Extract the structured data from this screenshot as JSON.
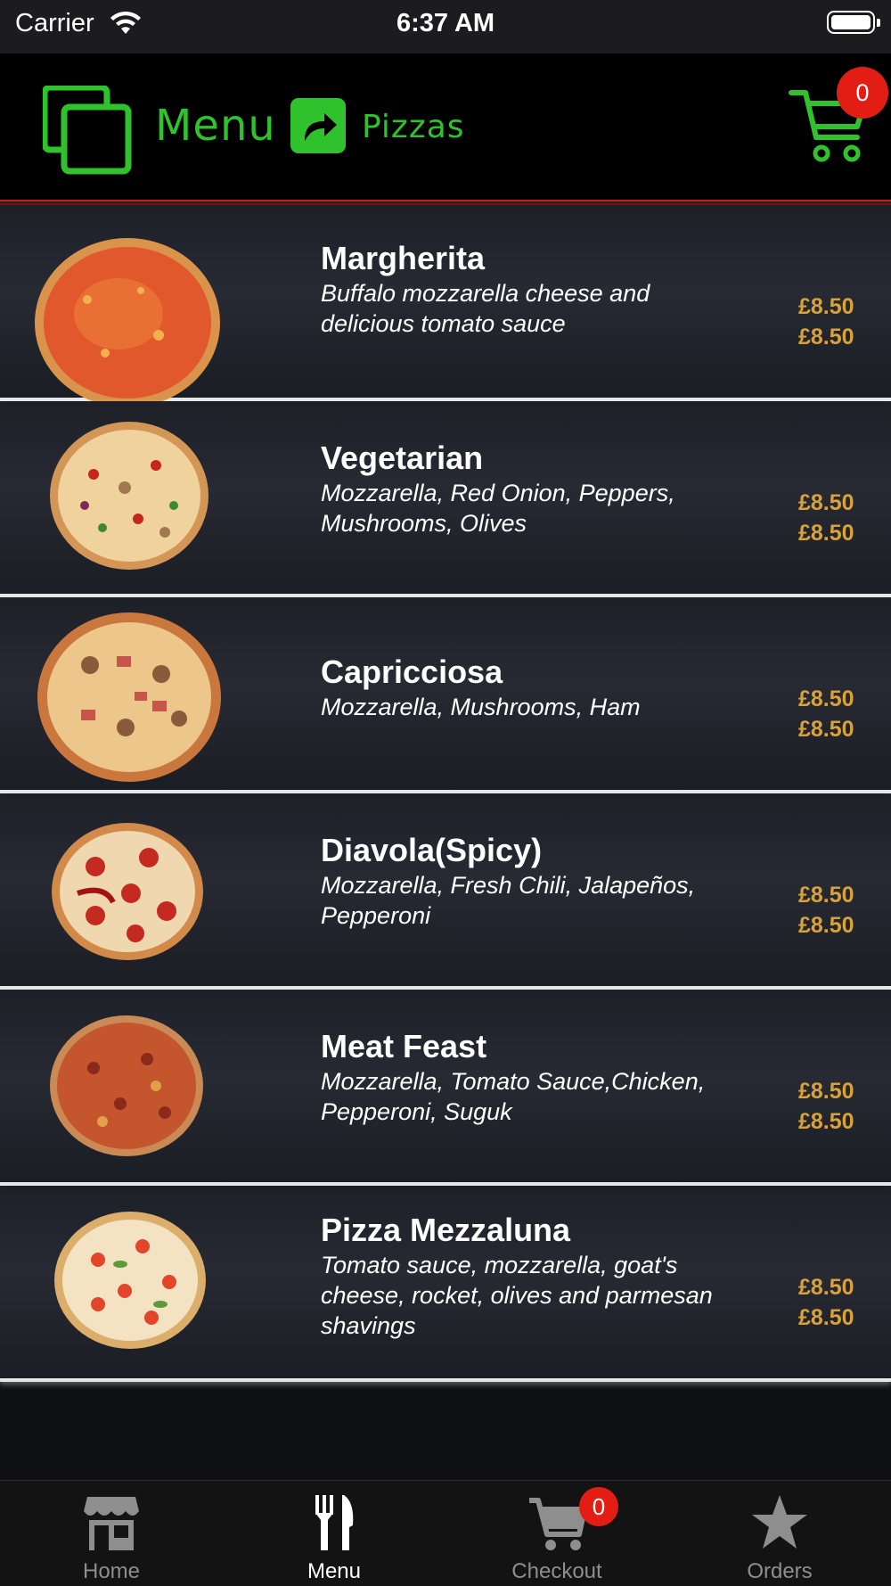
{
  "status_bar": {
    "carrier": "Carrier",
    "time": "6:37 AM"
  },
  "header": {
    "title": "Menu",
    "subtitle": "Pizzas",
    "cart_count": "0"
  },
  "colors": {
    "accent_green": "#2fc22c",
    "price_gold": "#d9a13a",
    "badge_red": "#e21d14",
    "divider_red": "#c81e1e"
  },
  "items": [
    {
      "name": "Margherita",
      "desc": "Buffalo mozzarella cheese and delicious tomato sauce",
      "prices": [
        "£8.50",
        "£8.50"
      ]
    },
    {
      "name": "Vegetarian",
      "desc": "Mozzarella, Red Onion, Peppers, Mushrooms, Olives",
      "prices": [
        "£8.50",
        "£8.50"
      ]
    },
    {
      "name": "Capricciosa",
      "desc": "Mozzarella, Mushrooms, Ham",
      "prices": [
        "£8.50",
        "£8.50"
      ]
    },
    {
      "name": "Diavola(Spicy)",
      "desc": "Mozzarella, Fresh Chili, Jalapeños, Pepperoni",
      "prices": [
        "£8.50",
        "£8.50"
      ]
    },
    {
      "name": "Meat Feast",
      "desc": "Mozzarella, Tomato Sauce,Chicken, Pepperoni, Suguk",
      "prices": [
        "£8.50",
        "£8.50"
      ]
    },
    {
      "name": "Pizza Mezzaluna",
      "desc": "Tomato sauce, mozzarella, goat's cheese, rocket, olives and parmesan shavings",
      "prices": [
        "£8.50",
        "£8.50"
      ]
    }
  ],
  "tabs": [
    {
      "label": "Home",
      "icon": "store-icon"
    },
    {
      "label": "Menu",
      "icon": "fork-knife-icon"
    },
    {
      "label": "Checkout",
      "icon": "cart-icon"
    },
    {
      "label": "Orders",
      "icon": "star-icon"
    }
  ],
  "checkout_badge": "0"
}
